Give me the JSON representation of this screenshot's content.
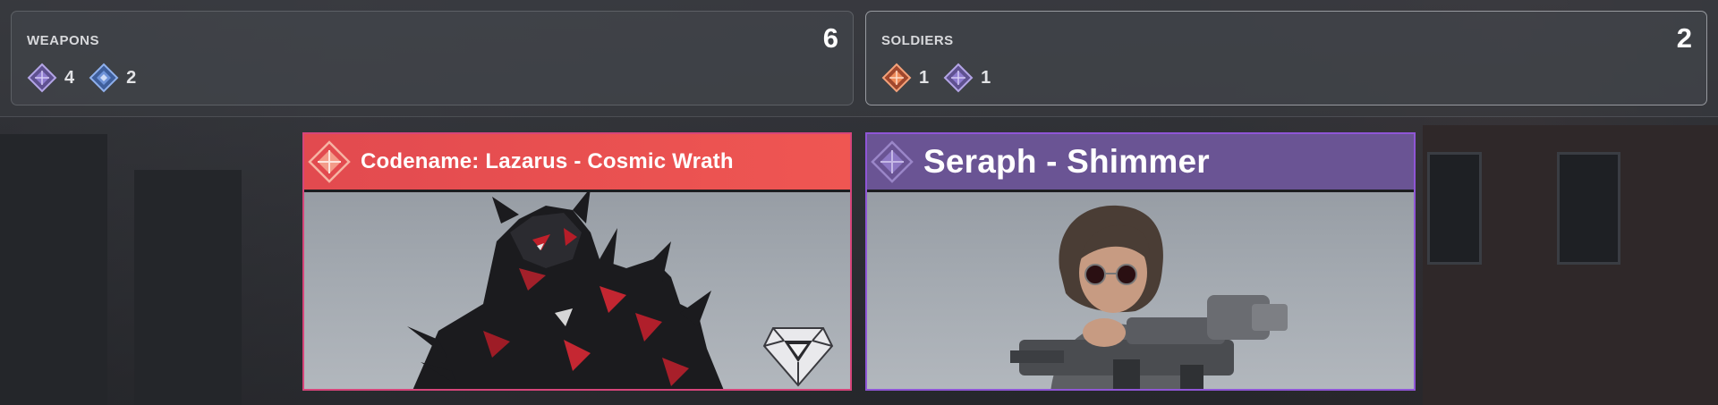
{
  "summary": {
    "weapons": {
      "title": "WEAPONS",
      "total": "6",
      "counts": [
        {
          "icon": "purple-diamond-rarity-icon",
          "color": "#9b86d6",
          "value": "4"
        },
        {
          "icon": "blue-diamond-rarity-icon",
          "color": "#6f93d8",
          "value": "2"
        }
      ]
    },
    "soldiers": {
      "title": "SOLDIERS",
      "total": "2",
      "counts": [
        {
          "icon": "orange-diamond-rarity-icon",
          "color": "#ee8a5a",
          "value": "1"
        },
        {
          "icon": "purple-diamond-rarity-icon",
          "color": "#9b86d6",
          "value": "1"
        }
      ]
    }
  },
  "cards": [
    {
      "name": "Codename: Lazarus - Cosmic Wrath",
      "header_color": "#ea4f50",
      "border_color": "#d6457a"
    },
    {
      "name": "Seraph - Shimmer",
      "header_color": "#6a5494",
      "border_color": "#8f56d6"
    }
  ]
}
